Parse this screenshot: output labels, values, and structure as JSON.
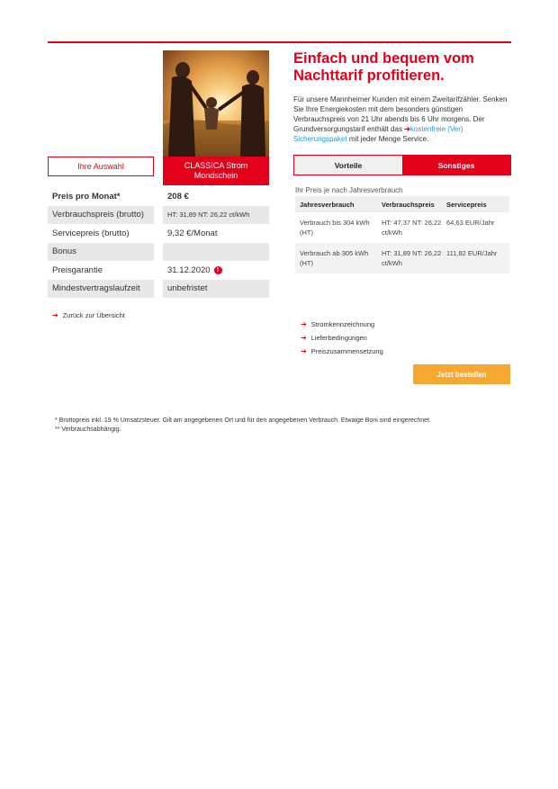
{
  "product": {
    "name_line1": "CLASSICA Strom",
    "name_line2": "Mondschein",
    "image": "family-sunset-field-photo"
  },
  "selection_label": "Ihre Auswahl",
  "price_table": [
    {
      "label": "Preis pro Monat*",
      "value": "208 €"
    },
    {
      "label": "Verbrauchspreis (brutto)",
      "value": "HT: 31,89  NT: 26,22 ct/kWh"
    },
    {
      "label": "Servicepreis (brutto)",
      "value": "9,32 €/Monat"
    },
    {
      "label": "Bonus",
      "value": ""
    },
    {
      "label": "Preisgarantie",
      "value": "31.12.2020"
    },
    {
      "label": "Mindestvertragslaufzeit",
      "value": "unbefristet"
    }
  ],
  "info_icon_glyph": "!",
  "back_link": "Zurück zur Übersicht",
  "arrow_glyph": "➔",
  "headline": {
    "line1": "Einfach und bequem vom",
    "line2": "Nachttarif profitieren."
  },
  "intro": {
    "text_before": "Für unsere Mannheimer Kunden mit einem Zweitarifzähler. Senken Sie Ihre Energiekosten mit dem besonders günstigen Verbrauchspreis von 21 Uhr abends bis 6 Uhr morgens. Der Grundversorgungstarif enthält das ",
    "link_text": "kostenfreie (Ver) Sicherungspaket",
    "text_after": " mit jeder Menge Service."
  },
  "tabs": {
    "tab1": "Vorteile",
    "tab2": "Sonstiges"
  },
  "price_caption": "Ihr Preis je nach Jahresverbrauch",
  "price_grid": {
    "headers": [
      "Jahresverbrauch",
      "Verbrauchspreis",
      "Servicepreis"
    ],
    "rows": [
      {
        "consumption": "Verbrauch bis 304 kWh (HT)",
        "price": "HT: 47,37 NT: 26,22 ct/kWh",
        "service": "64,63 EUR/Jahr"
      },
      {
        "consumption": "Verbrauch ab 305 kWh (HT)",
        "price": "HT: 31,89 NT: 26,22 ct/kWh",
        "service": "111,82 EUR/Jahr"
      }
    ]
  },
  "doc_links": [
    "Stromkennzeichnung",
    "Lieferbedingungen",
    "Preiszusammensetzung"
  ],
  "order_button": "Jetzt bestellen",
  "footnotes": {
    "line1": "* Bruttopreis inkl. 19 % Umsatzsteuer. Gilt am angegebenen Ort und für den angegebenen Verbrauch. Etwaige Boni sind eingerechnet.",
    "line2": "** Verbrauchsabhängig."
  },
  "colors": {
    "brand_red": "#e2001a",
    "order_orange": "#f7a830",
    "link_blue": "#1a9bd7"
  }
}
